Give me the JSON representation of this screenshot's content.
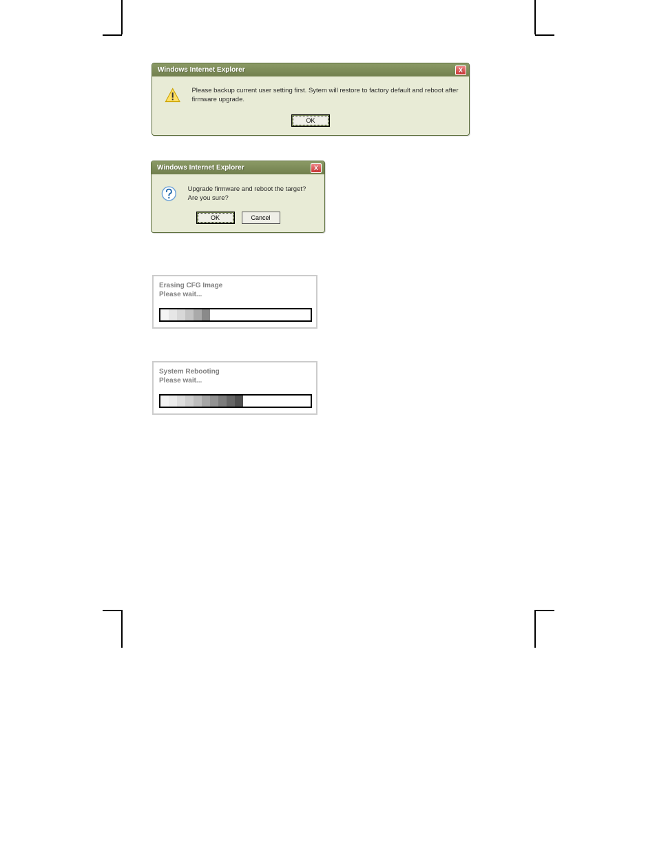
{
  "dialog1": {
    "title": "Windows Internet Explorer",
    "message": "Please backup current user setting first. Sytem will restore to factory default and reboot after firmware upgrade.",
    "ok_label": "OK",
    "close_label": "X"
  },
  "dialog2": {
    "title": "Windows Internet Explorer",
    "message": "Upgrade firmware and reboot the target? Are you sure?",
    "ok_label": "OK",
    "cancel_label": "Cancel",
    "close_label": "X"
  },
  "panel1": {
    "title": "Erasing CFG Image",
    "subtitle": "Please wait..."
  },
  "panel2": {
    "title": "System Rebooting",
    "subtitle": "Please wait..."
  }
}
